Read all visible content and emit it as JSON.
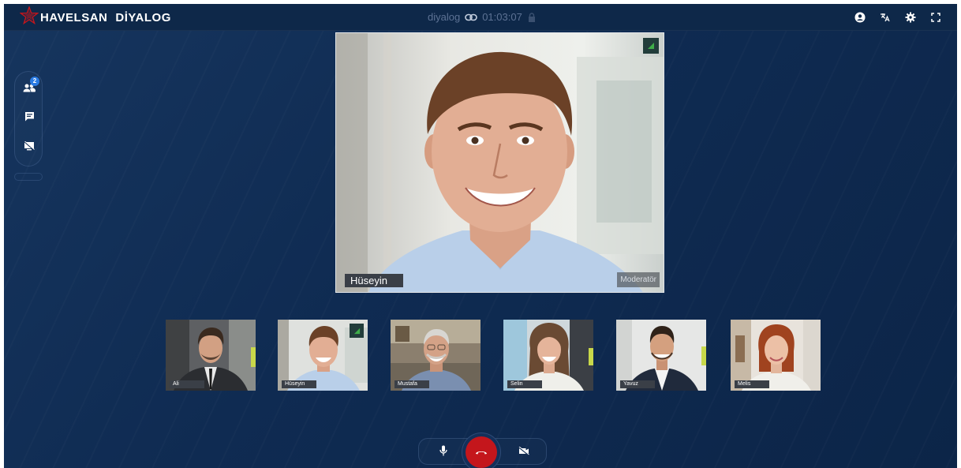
{
  "brand": {
    "name": "HAVELSAN",
    "product": "DİYALOG"
  },
  "room": {
    "name": "diyalog",
    "timer": "01:03:07"
  },
  "top_actions": [
    {
      "icon": "user-icon"
    },
    {
      "icon": "translate-icon"
    },
    {
      "icon": "gear-icon"
    },
    {
      "icon": "fullscreen-icon"
    }
  ],
  "side_rail": {
    "participants_count": "2",
    "items": [
      {
        "icon": "participants-icon"
      },
      {
        "icon": "chat-icon"
      },
      {
        "icon": "screen-share-off-icon"
      }
    ]
  },
  "main_speaker": {
    "name": "Hüseyin",
    "role": "Moderatör"
  },
  "participants": [
    {
      "name": "Ali"
    },
    {
      "name": "Hüseyin"
    },
    {
      "name": "Mustafa"
    },
    {
      "name": "Selin"
    },
    {
      "name": "Yavuz"
    },
    {
      "name": "Melis"
    }
  ],
  "controls": [
    {
      "icon": "microphone-icon"
    },
    {
      "icon": "hang-up-icon"
    },
    {
      "icon": "camera-off-icon"
    }
  ],
  "colors": {
    "background": "#0f2b52",
    "topbar": "#0e2849",
    "hangup": "#c4161c",
    "badge": "#2a7be4",
    "brand_star": "#c4161c"
  }
}
